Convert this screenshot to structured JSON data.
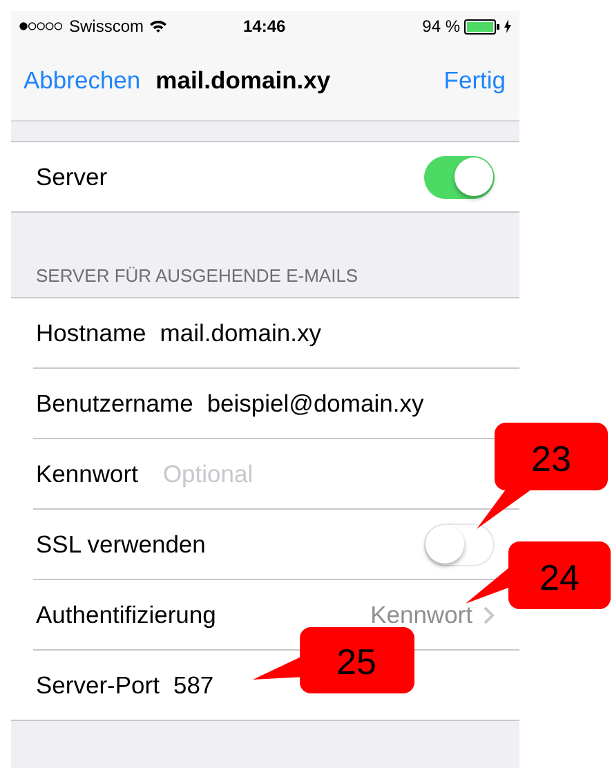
{
  "status_bar": {
    "carrier": "Swisscom",
    "time": "14:46",
    "battery": "94 %"
  },
  "nav": {
    "cancel": "Abbrechen",
    "title": "mail.domain.xy",
    "done": "Fertig"
  },
  "sections": [
    {
      "rows": [
        {
          "kind": "toggle",
          "label": "Server",
          "on": true
        }
      ]
    },
    {
      "header": "SERVER FÜR AUSGEHENDE E-MAILS",
      "rows": [
        {
          "kind": "value",
          "label": "Hostname",
          "value": "mail.domain.xy"
        },
        {
          "kind": "value",
          "label": "Benutzername",
          "value": "beispiel@domain.xy"
        },
        {
          "kind": "input",
          "label": "Kennwort",
          "placeholder": "Optional"
        },
        {
          "kind": "toggle",
          "label": "SSL verwenden",
          "on": false
        },
        {
          "kind": "disclosure",
          "label": "Authentifizierung",
          "value": "Kennwort"
        },
        {
          "kind": "value",
          "label": "Server-Port",
          "value": "587"
        }
      ]
    }
  ],
  "callouts": [
    {
      "label": "23"
    },
    {
      "label": "24"
    },
    {
      "label": "25"
    }
  ]
}
